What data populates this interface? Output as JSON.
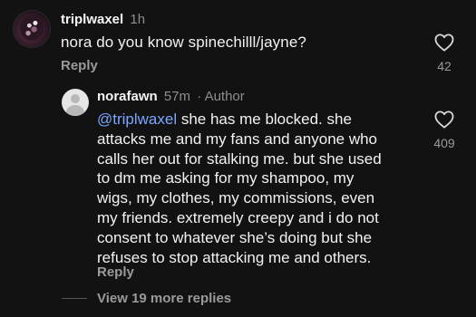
{
  "comment": {
    "username": "triplwaxel",
    "time": "1h",
    "text": "nora do you know spinechilll/jayne?",
    "reply_label": "Reply",
    "likes": "42",
    "like_icon": "heart-outline-icon"
  },
  "reply": {
    "username": "norafawn",
    "time": "57m",
    "separator": "·",
    "author_tag": "Author",
    "mention": "@triplwaxel",
    "text_lines": [
      " she has me blocked. she",
      "attacks me and my fans and anyone who",
      "calls her out for stalking me. but she used",
      "to dm me asking for my shampoo, my",
      "wigs, my clothes, my commissions, even",
      "my friends. extremely creepy and i do not",
      "consent to whatever she’s doing but she",
      "refuses to stop attacking me and others."
    ],
    "reply_label": "Reply",
    "likes": "409",
    "like_icon": "heart-outline-icon"
  },
  "thread": {
    "view_more_label": "View 19 more replies"
  },
  "colors": {
    "background": "#121212",
    "text": "#f2f2f2",
    "muted": "#8e8e8e",
    "mention": "#7aa7ff"
  }
}
